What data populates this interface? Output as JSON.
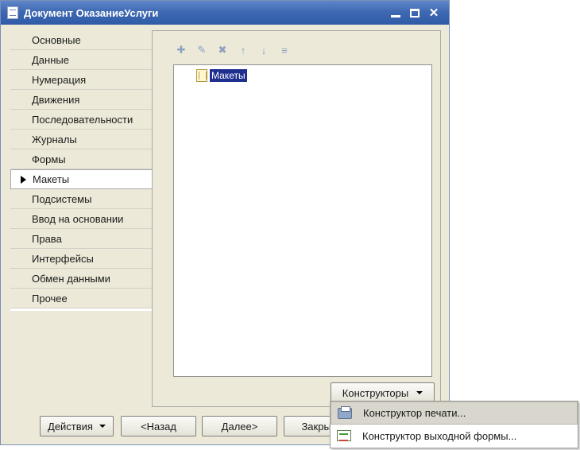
{
  "window": {
    "title": "Документ ОказаниеУслуги",
    "minimize_glyph": "",
    "maximize_glyph": "",
    "close_glyph": "✕"
  },
  "nav": {
    "items": [
      {
        "label": "Основные",
        "active": false
      },
      {
        "label": "Данные",
        "active": false
      },
      {
        "label": "Нумерация",
        "active": false
      },
      {
        "label": "Движения",
        "active": false
      },
      {
        "label": "Последовательности",
        "active": false
      },
      {
        "label": "Журналы",
        "active": false
      },
      {
        "label": "Формы",
        "active": false
      },
      {
        "label": "Макеты",
        "active": true
      },
      {
        "label": "Подсистемы",
        "active": false
      },
      {
        "label": "Ввод на основании",
        "active": false
      },
      {
        "label": "Права",
        "active": false
      },
      {
        "label": "Интерфейсы",
        "active": false
      },
      {
        "label": "Обмен данными",
        "active": false
      },
      {
        "label": "Прочее",
        "active": false
      }
    ]
  },
  "toolbar": {
    "buttons": [
      {
        "icon": "add-icon",
        "glyph": "✚"
      },
      {
        "icon": "edit-icon",
        "glyph": "✎"
      },
      {
        "icon": "delete-icon",
        "glyph": "✖"
      },
      {
        "icon": "move-up-icon",
        "glyph": "↑"
      },
      {
        "icon": "move-down-icon",
        "glyph": "↓"
      },
      {
        "icon": "sort-icon",
        "glyph": "≡"
      }
    ]
  },
  "tree": {
    "root_label": "Макеты"
  },
  "buttons": {
    "constructors": "Конструкторы",
    "actions": "Действия",
    "back": "<Назад",
    "next": "Далее>",
    "close": "Закрыть"
  },
  "popup": {
    "items": [
      {
        "label": "Конструктор печати...",
        "icon": "print-designer-icon",
        "highlighted": true
      },
      {
        "label": "Конструктор выходной формы...",
        "icon": "output-form-designer-icon",
        "highlighted": false
      }
    ]
  }
}
